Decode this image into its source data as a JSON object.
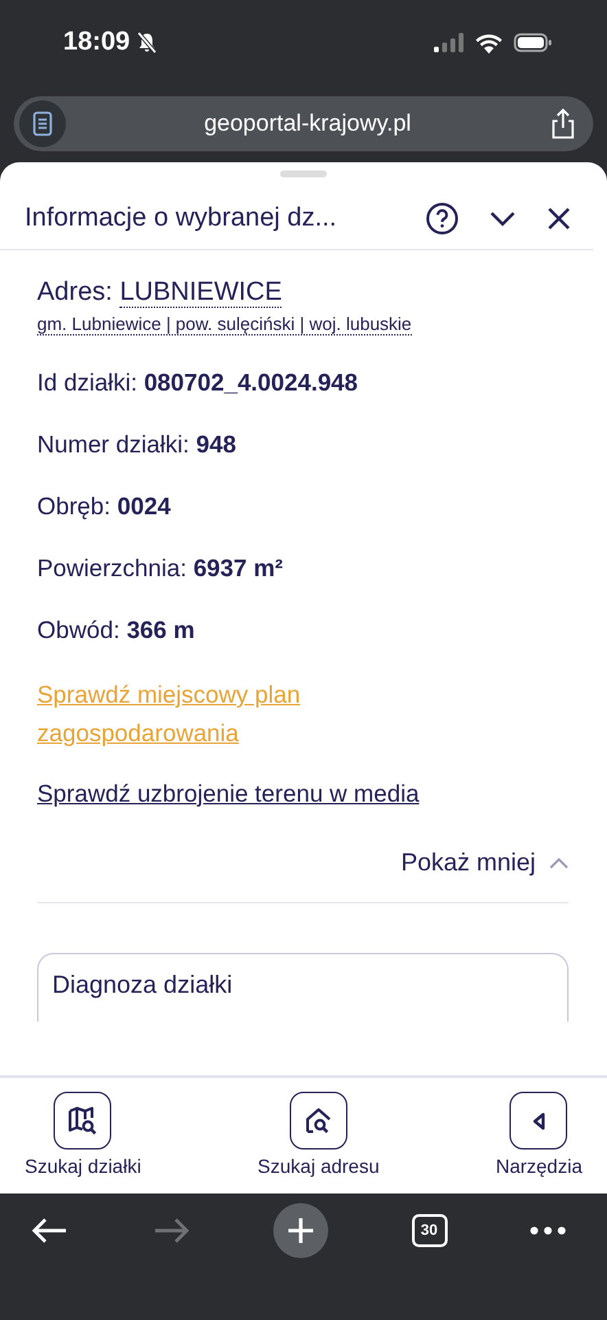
{
  "status_bar": {
    "time": "18:09",
    "silent": true
  },
  "address_bar": {
    "url": "geoportal-krajowy.pl"
  },
  "panel": {
    "title": "Informacje o wybranej dz...",
    "address": {
      "label": "Adres:",
      "value": "LUBNIEWICE",
      "region": "gm. Lubniewice | pow. sulęciński | woj. lubuskie"
    },
    "fields": [
      {
        "label": "Id działki:",
        "value": "080702_4.0024.948"
      },
      {
        "label": "Numer działki:",
        "value": "948"
      },
      {
        "label": "Obręb:",
        "value": "0024"
      },
      {
        "label": "Powierzchnia:",
        "value": "6937 m²"
      },
      {
        "label": "Obwód:",
        "value": "366 m"
      }
    ],
    "links": [
      {
        "text": "Sprawdź miejscowy plan zagospodarowania",
        "highlighted": true
      },
      {
        "text": "Sprawdź uzbrojenie terenu w media",
        "highlighted": false
      }
    ],
    "toggle": {
      "label": "Pokaż mniej",
      "expanded": true
    },
    "card": {
      "title": "Diagnoza działki"
    }
  },
  "bottom_nav": [
    {
      "label": "Szukaj działki",
      "kind": "map"
    },
    {
      "label": "Szukaj adresu",
      "kind": "house"
    },
    {
      "label": "Narzędzia",
      "kind": "collapse"
    }
  ],
  "browser_toolbar": {
    "back_disabled": false,
    "forward_disabled": true,
    "tab_count": "30"
  }
}
